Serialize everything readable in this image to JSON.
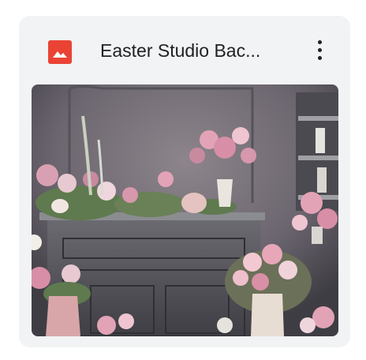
{
  "file_card": {
    "title": "Easter Studio Bac...",
    "file_type_icon": "image-file-icon",
    "menu_icon": "more-vert-icon",
    "accent_color": "#ea4335",
    "thumbnail": {
      "subject": "easter-studio-backdrop",
      "palette": {
        "wall": "#6f6a72",
        "mantel": "#58585e",
        "flowers": "#e3a3b6",
        "foliage": "#5f7a4e",
        "vase": "#e8ddd3"
      }
    }
  }
}
